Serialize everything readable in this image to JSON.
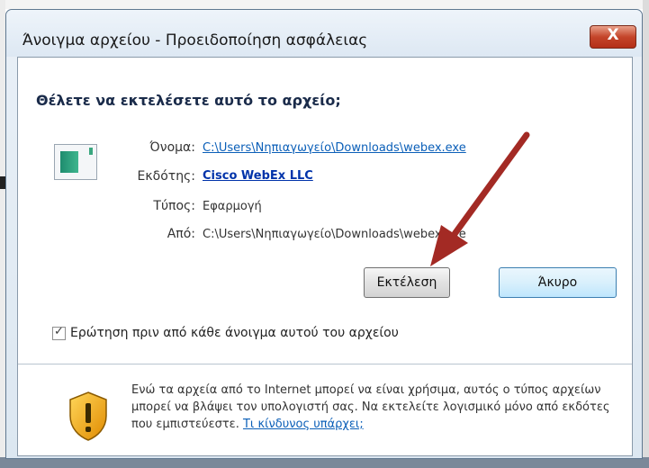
{
  "dialog": {
    "title": "Άνοιγμα αρχείου - Προειδοποίηση ασφάλειας",
    "close_label": "X",
    "heading": "Θέλετε να εκτελέσετε αυτό το αρχείο;",
    "fields": {
      "name_label": "Όνομα:",
      "name_value": "C:\\Users\\Νηπιαγωγείο\\Downloads\\webex.exe",
      "publisher_label": "Εκδότης:",
      "publisher_value": "Cisco WebEx LLC",
      "type_label": "Τύπος:",
      "type_value": "Εφαρμογή",
      "from_label": "Από:",
      "from_value": "C:\\Users\\Νηπιαγωγείο\\Downloads\\webex.exe"
    },
    "buttons": {
      "run": "Εκτέλεση",
      "cancel": "Άκυρο"
    },
    "checkbox": {
      "label": "Ερώτηση πριν από κάθε άνοιγμα αυτού του αρχείου",
      "checked": true,
      "mark": "✓"
    },
    "warning": {
      "text": "Ενώ τα αρχεία από το Internet μπορεί να είναι χρήσιμα, αυτός ο τύπος αρχείων μπορεί να βλάψει τον υπολογιστή σας. Να εκτελείτε λογισμικό μόνο από εκδότες που εμπιστεύεστε.",
      "link": "Τι κίνδυνος υπάρχει;"
    }
  },
  "icons": {
    "file": "application-file-icon",
    "warning": "shield-warning-icon",
    "annotation": "red-arrow-annotation"
  },
  "colors": {
    "link": "#0b5fb8",
    "close_button": "#c4452a",
    "arrow": "#a32a24"
  }
}
